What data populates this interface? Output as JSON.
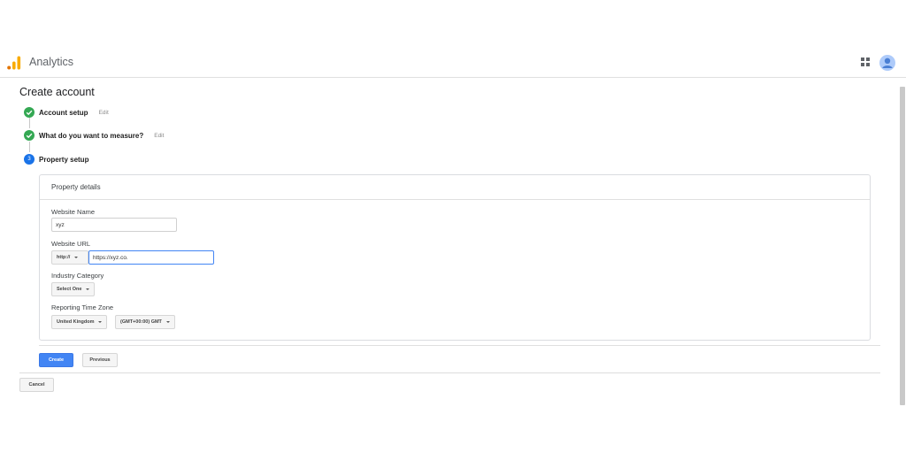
{
  "header": {
    "app_title": "Analytics",
    "brand_colors": {
      "bar_short": "#e37400",
      "bar_mid": "#f9ab00",
      "bar_tall": "#f9ab00"
    },
    "apps_icon": "apps-grid-icon",
    "avatar_icon": "account-avatar-icon"
  },
  "page": {
    "title": "Create account"
  },
  "steps": [
    {
      "label": "Account setup",
      "edit": "Edit",
      "status": "complete"
    },
    {
      "label": "What do you want to measure?",
      "edit": "Edit",
      "status": "complete"
    },
    {
      "label": "Property setup",
      "number": "3",
      "status": "current"
    }
  ],
  "property": {
    "header": "Property details",
    "website_name": {
      "label": "Website Name",
      "value": "xyz"
    },
    "website_url": {
      "label": "Website URL",
      "protocol": "http://",
      "value": "https://xyz.co."
    },
    "industry": {
      "label": "Industry Category",
      "value": "Select One"
    },
    "timezone": {
      "label": "Reporting Time Zone",
      "country": "United Kingdom",
      "zone": "(GMT+00:00) GMT"
    }
  },
  "actions": {
    "create": "Create",
    "previous": "Previous",
    "cancel": "Cancel"
  },
  "colors": {
    "accent": "#4285f4",
    "success": "#34a853",
    "step_current": "#1a73e8"
  }
}
